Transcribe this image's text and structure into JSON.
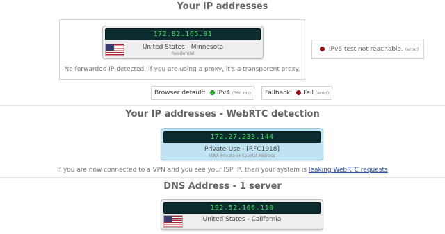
{
  "section1": {
    "title": "Your IP addresses",
    "ip": "172.82.165.91",
    "location": "United States - Minnesota",
    "type": "Residential",
    "forwarded_note": "No forwarded IP detected. If you are using a proxy, it's a transparent proxy.",
    "ipv6_text": "IPv6 test not reachable.",
    "ipv6_error": "(error)",
    "browser_default_label": "Browser default:",
    "browser_default_value": "IPv4",
    "browser_default_ms": "(360 ms)",
    "fallback_label": "Fallback:",
    "fallback_value": "Fail",
    "fallback_error": "(error)"
  },
  "section2": {
    "title": "Your IP addresses - WebRTC detection",
    "ip": "172.27.233.144",
    "location": "Private-Use - [RFC1918]",
    "type": "IANA Private or Special Address",
    "note_prefix": "If you are now connected to a VPN and you see your ISP IP, then your system is",
    "note_link": "leaking WebRTC requests"
  },
  "section3": {
    "title": "DNS Address - 1 server",
    "ip": "192.52.166.110",
    "location": "United States - California"
  },
  "colors": {
    "lcd_bg": "#0c2b2f",
    "lcd_text": "#38e05a",
    "status_ok": "#1fbd2c",
    "status_fail": "#b50e14",
    "webrtc_card": "#bfe3f3",
    "link": "#2b4fb3"
  },
  "icons": {
    "flag": "us-flag-icon",
    "ok": "green-status-dot-icon",
    "fail": "red-status-dot-icon"
  }
}
